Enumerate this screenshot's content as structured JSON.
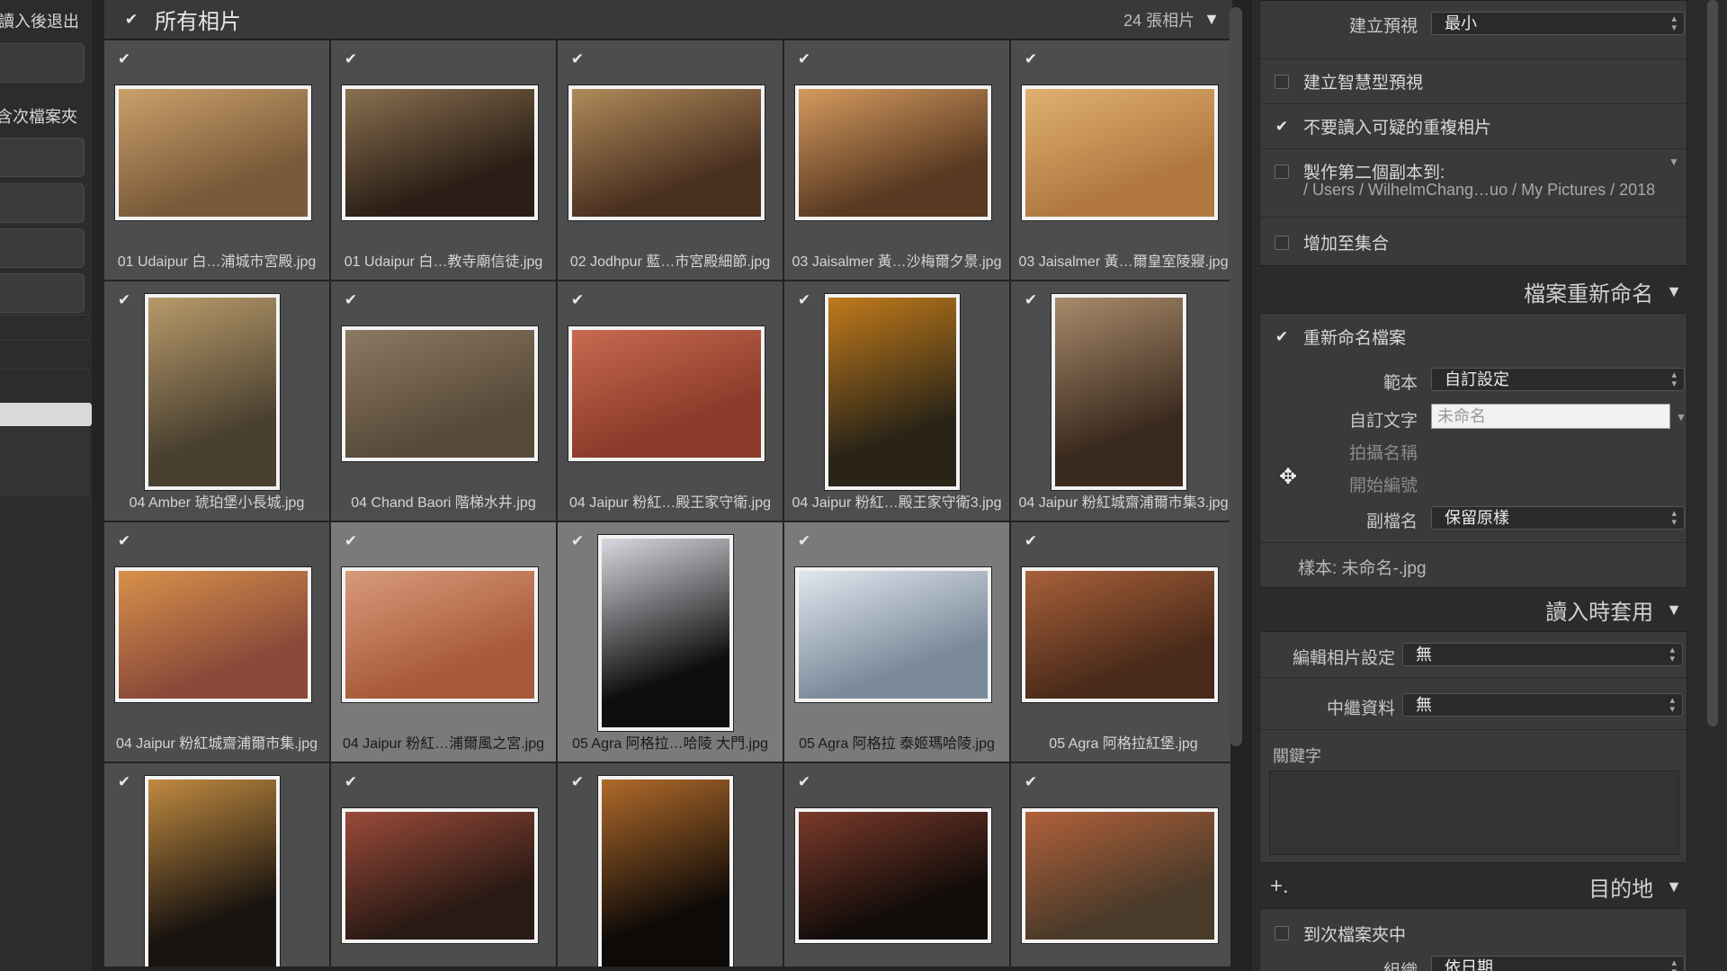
{
  "left": {
    "labels": [
      "讀入後退出",
      "含次檔案夾"
    ]
  },
  "grid": {
    "title": "所有相片",
    "count": "24 張相片",
    "items": [
      {
        "name": "01 Udaipur 白…浦城市宮殿.jpg",
        "orient": "land",
        "c1": "#7a5a3a",
        "c2": "#caa06a",
        "checked": true
      },
      {
        "name": "01 Udaipur 白…教寺廟信徒.jpg",
        "orient": "land",
        "c1": "#2a1e16",
        "c2": "#8a7050",
        "checked": true
      },
      {
        "name": "02 Jodhpur 藍…市宮殿細節.jpg",
        "orient": "land",
        "c1": "#4a3020",
        "c2": "#b08a5a",
        "checked": true
      },
      {
        "name": "03 Jaisalmer 黃…沙梅爾夕景.jpg",
        "orient": "land",
        "c1": "#5a3a22",
        "c2": "#d49a5e",
        "checked": true
      },
      {
        "name": "03 Jaisalmer 黃…爾皇室陵寢.jpg",
        "orient": "land",
        "c1": "#b07840",
        "c2": "#e0b070",
        "checked": true
      },
      {
        "name": "04 Amber 琥珀堡小長城.jpg",
        "orient": "port",
        "c1": "#4a4030",
        "c2": "#b89a6a",
        "checked": true
      },
      {
        "name": "04 Chand Baori 階梯水井.jpg",
        "orient": "land",
        "c1": "#5a4a3a",
        "c2": "#8a7a62",
        "checked": true
      },
      {
        "name": "04 Jaipur 粉紅…殿王家守衛.jpg",
        "orient": "land",
        "c1": "#8a3a2a",
        "c2": "#c86a50",
        "checked": true
      },
      {
        "name": "04 Jaipur 粉紅…殿王家守衛3.jpg",
        "orient": "port",
        "c1": "#2a2418",
        "c2": "#c07a1a",
        "checked": true
      },
      {
        "name": "04 Jaipur 粉紅城齋浦爾市集3.jpg",
        "orient": "port",
        "c1": "#3a2a1e",
        "c2": "#a88a6a",
        "checked": true
      },
      {
        "name": "04 Jaipur 粉紅城齋浦爾市集.jpg",
        "orient": "land",
        "c1": "#8a4a3a",
        "c2": "#d8904a",
        "checked": true
      },
      {
        "name": "04 Jaipur 粉紅…浦爾風之宮.jpg",
        "orient": "land",
        "c1": "#a85a3a",
        "c2": "#d89a7a",
        "checked": true,
        "hl": true
      },
      {
        "name": "05 Agra 阿格拉…哈陵 大門.jpg",
        "orient": "port",
        "c1": "#0e0e0e",
        "c2": "#d8d8e0",
        "checked": true,
        "hl": true
      },
      {
        "name": "05 Agra 阿格拉 泰姬瑪哈陵.jpg",
        "orient": "land",
        "c1": "#7a8a9a",
        "c2": "#e0e6ee",
        "checked": true,
        "hl": true
      },
      {
        "name": "05 Agra 阿格拉紅堡.jpg",
        "orient": "land",
        "c1": "#4a2a1a",
        "c2": "#a8603a",
        "checked": true
      },
      {
        "name": "",
        "orient": "port",
        "c1": "#1a1410",
        "c2": "#c08a40",
        "checked": true
      },
      {
        "name": "",
        "orient": "land",
        "c1": "#2a1a14",
        "c2": "#9a4a3a",
        "checked": true
      },
      {
        "name": "",
        "orient": "port",
        "c1": "#0e0a08",
        "c2": "#b06a2a",
        "checked": true
      },
      {
        "name": "",
        "orient": "land",
        "c1": "#120c0a",
        "c2": "#7a3a2a",
        "checked": true
      },
      {
        "name": "",
        "orient": "land",
        "c1": "#4a3a2a",
        "c2": "#b0603a",
        "checked": true
      }
    ]
  },
  "panel": {
    "build_preview_label": "建立預視",
    "build_preview_value": "最小",
    "smart_preview": "建立智慧型預視",
    "no_duplicates": "不要讀入可疑的重複相片",
    "second_copy": "製作第二個副本到:",
    "second_copy_path": "/ Users / WilhelmChang…uo / My Pictures / 2018",
    "add_collection": "增加至集合",
    "rename_section": "檔案重新命名",
    "rename_files": "重新命名檔案",
    "template_label": "範本",
    "template_value": "自訂設定",
    "custom_text_label": "自訂文字",
    "custom_text_placeholder": "未命名",
    "shoot_name_label": "拍攝名稱",
    "start_number_label": "開始編號",
    "extension_label": "副檔名",
    "extension_value": "保留原樣",
    "sample": "樣本:  未命名-.jpg",
    "apply_section": "讀入時套用",
    "develop_label": "編輯相片設定",
    "develop_value": "無",
    "metadata_label": "中繼資料",
    "metadata_value": "無",
    "keywords_label": "關鍵字",
    "destination_section": "目的地",
    "into_subfolder": "到次檔案夾中",
    "organize_label": "組織",
    "organize_value": "依日期"
  }
}
